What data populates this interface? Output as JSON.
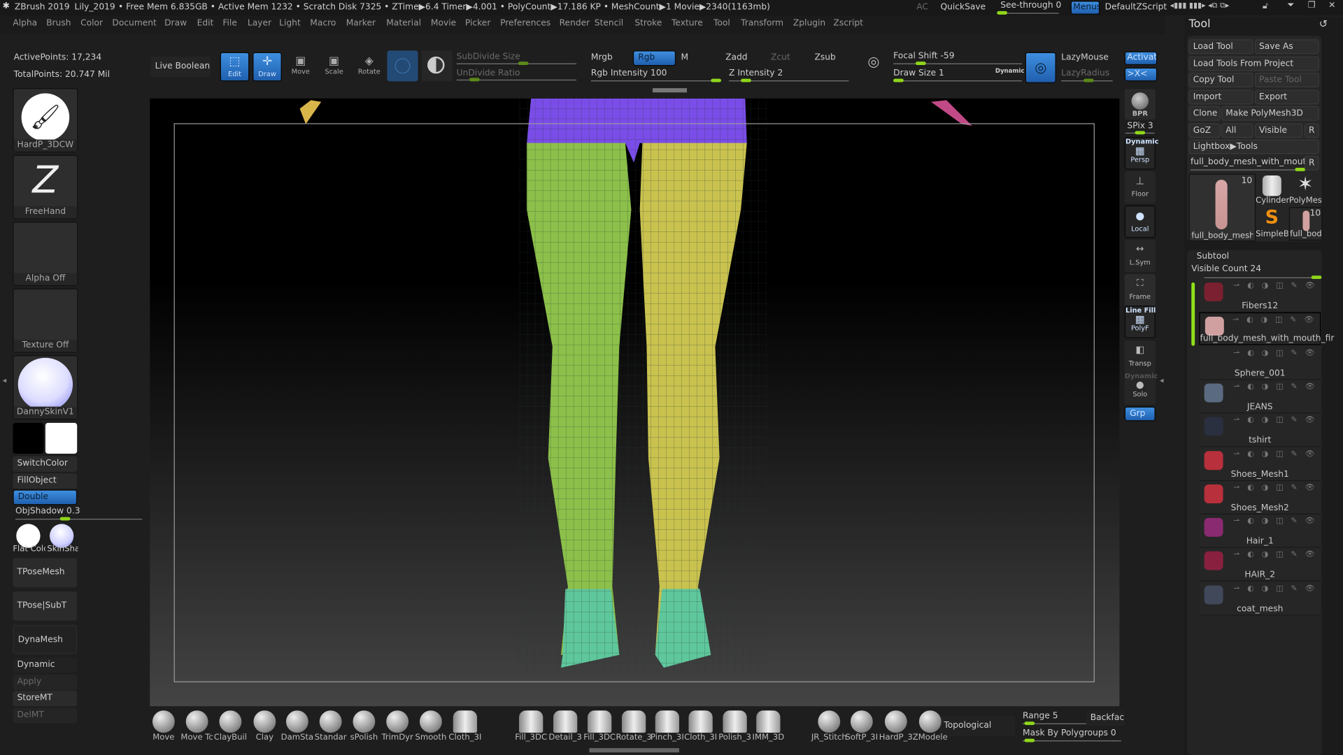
{
  "titlebar": {
    "app": "ZBrush 2019",
    "document": "Lily_2019",
    "stats": "• Free Mem 6.835GB • Active Mem 1232 • Scratch Disk 7325 • ZTime▶6.4 Timer▶4.001 • PolyCount▶17.186 KP • MeshCount▶1 Movie▶2340(1163mb)",
    "ac": "AC",
    "quicksave": "QuickSave",
    "see_through": "See-through  0",
    "see_through_value": 0,
    "menus": "Menus",
    "script": "DefaultZScript"
  },
  "menubar": [
    "Alpha",
    "Brush",
    "Color",
    "Document",
    "Draw",
    "Edit",
    "File",
    "Layer",
    "Light",
    "Macro",
    "Marker",
    "Material",
    "Movie",
    "Picker",
    "Preferences",
    "Render",
    "Stencil",
    "Stroke",
    "Texture",
    "Tool",
    "Transform",
    "Zplugin",
    "Zscript"
  ],
  "shelf": {
    "live_boolean": "Live Boolean",
    "edit": "Edit",
    "draw": "Draw",
    "move": "Move",
    "scale": "Scale",
    "rotate": "Rotate",
    "subdivide_size": "SubDivide Size",
    "undivide_ratio": "UnDivide Ratio",
    "mrgb": "Mrgb",
    "rgb": "Rgb",
    "m": "M",
    "zadd": "Zadd",
    "zcut": "Zcut",
    "zsub": "Zsub",
    "rgb_intensity": "Rgb Intensity 100",
    "z_intensity": "Z Intensity 2",
    "focal_shift": "Focal Shift -59",
    "draw_size": "Draw Size 1",
    "dynamic": "Dynamic",
    "lazymouse": "LazyMouse",
    "lazyradius": "LazyRadius",
    "activate": "Activate",
    "x_sym": ">X<"
  },
  "left": {
    "active_points": "ActivePoints: 17,234",
    "total_points": "TotalPoints: 20.747 Mil",
    "brush": "HardP_3DCW",
    "stroke": "FreeHand",
    "alpha": "Alpha Off",
    "texture": "Texture Off",
    "material": "DannySkinV1",
    "switch_color": "SwitchColor",
    "fill_object": "FillObject",
    "double": "Double",
    "obj_shadow": "ObjShadow 0.3",
    "obj_shadow_value": 0.3,
    "mat1": "Flat Colc",
    "mat2": "SkinSha",
    "tpose_mesh": "TPoseMesh",
    "tpose_subt": "TPose|SubT",
    "dynamesh": "DynaMesh",
    "dynamic": "Dynamic",
    "apply": "Apply",
    "store_mt": "StoreMT",
    "del_mt": "DelMT",
    "colors": {
      "primary": "#000000",
      "secondary": "#ffffff"
    }
  },
  "rightshelf": {
    "bpr": "BPR",
    "spix": "SPix 3",
    "persp_top": "Dynamic",
    "persp": "Persp",
    "floor": "Floor",
    "local": "Local",
    "lsym": "L.Sym",
    "frame": "Frame",
    "polyf_top": "Line Fill",
    "polyf": "PolyF",
    "transp": "Transp",
    "solo_top": "Dynamic",
    "solo": "Solo",
    "grp": "Grp"
  },
  "tool": {
    "title": "Tool",
    "load_tool": "Load Tool",
    "save_as": "Save As",
    "load_from_project": "Load Tools From Project",
    "copy_tool": "Copy Tool",
    "paste_tool": "Paste Tool",
    "import": "Import",
    "export": "Export",
    "clone": "Clone",
    "make_polymesh": "Make PolyMesh3D",
    "goz": "GoZ",
    "all": "All",
    "visible": "Visible",
    "r": "R",
    "lightbox": "Lightbox▶Tools",
    "current_tool": "full_body_mesh_with_mouth_f",
    "thumbs": [
      {
        "label": "full_body_mesh_",
        "count": "10"
      },
      {
        "label": "Cylinder"
      },
      {
        "label": "PolyMes"
      },
      {
        "label": "SimpleB"
      },
      {
        "label": "full_bod",
        "count": "10"
      }
    ]
  },
  "subtool": {
    "title": "Subtool",
    "visible_count": "Visible Count 24",
    "items": [
      "Fibers12",
      "full_body_mesh_with_mouth_fir",
      "Sphere_001",
      "JEANS",
      "tshirt",
      "Shoes_Mesh1",
      "Shoes_Mesh2",
      "Hair_1",
      "HAIR_2",
      "coat_mesh"
    ]
  },
  "bottom": {
    "brushes": [
      "Move",
      "Move Tc",
      "ClayBuil",
      "Clay",
      "DamSta",
      "Standar",
      "sPolish",
      "TrimDyr",
      "Smooth",
      "Cloth_3I"
    ],
    "brushes2": [
      "Fill_3DC",
      "Detail_3",
      "Fill_3DC",
      "Rotate_3",
      "Pinch_3I",
      "Cloth_3I",
      "Polish_3",
      "IMM_3D"
    ],
    "brushes3": [
      "JR_Stitch",
      "SoftP_3I",
      "HardP_3",
      "ZModele"
    ],
    "topological": "Topological",
    "range": "Range 5",
    "backface": "Backfac",
    "mask_polygroups": "Mask By Polygroups 0"
  }
}
